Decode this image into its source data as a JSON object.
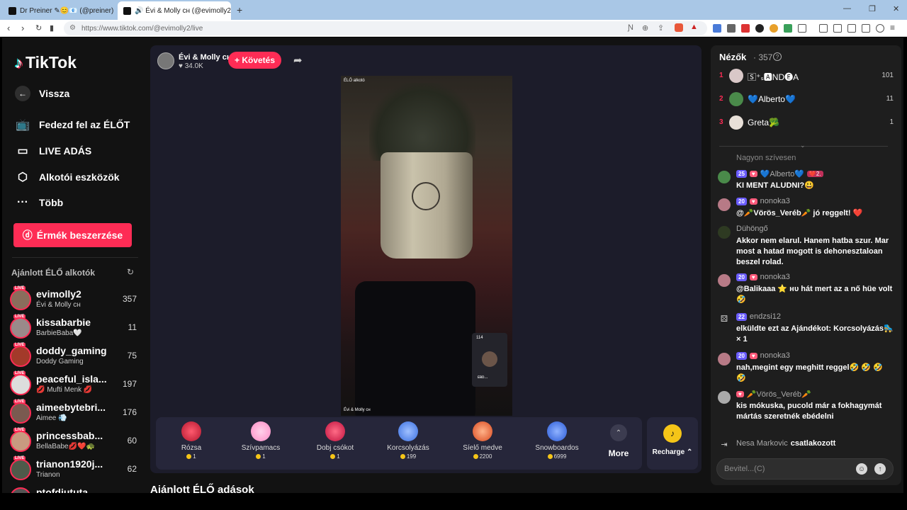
{
  "browser": {
    "tabs": [
      {
        "title": "Dr Preiner ✎😊📧 (@preiner) ÉLŐ",
        "active": false
      },
      {
        "title": "🔊 Évi & Molly ᴄʜ (@evimolly2) É",
        "active": true
      }
    ],
    "new_tab": "+",
    "url": "https://www.tiktok.com/@evimolly2/live",
    "window_controls": [
      "—",
      "❐",
      "✕"
    ]
  },
  "sidebar": {
    "logo": "TikTok",
    "back": "Vissza",
    "nav": [
      {
        "label": "Fedezd fel az ÉLŐT",
        "icon": "tv-icon"
      },
      {
        "label": "LIVE ADÁS",
        "icon": "camera-icon"
      },
      {
        "label": "Alkotói eszközök",
        "icon": "creator-tools-icon"
      },
      {
        "label": "Több",
        "icon": "more-icon"
      }
    ],
    "coins_button": "Érmék beszerzése",
    "recommended_title": "Ajánlott ÉLŐ alkotók",
    "live_badge": "LIVE",
    "creators": [
      {
        "name": "evimolly2",
        "sub": "Évi & Molly ᴄʜ",
        "count": "357"
      },
      {
        "name": "kissabarbie",
        "sub": "BarbieBaba🤍",
        "count": "11"
      },
      {
        "name": "doddy_gaming",
        "sub": "Doddy Gaming",
        "count": "75"
      },
      {
        "name": "peaceful_isla...",
        "sub": "💋 Mufti Menk 💋",
        "count": "197"
      },
      {
        "name": "aimeebytebri...",
        "sub": "Aimee 💨",
        "count": "176"
      },
      {
        "name": "princessbab...",
        "sub": "BellaBabe💋❤️🐢",
        "count": "60"
      },
      {
        "name": "trianon1920j...",
        "sub": "Trianon",
        "count": "62"
      },
      {
        "name": "ptofdiututa",
        "sub": "",
        "count": ""
      }
    ]
  },
  "live": {
    "host_name": "Évi & Molly ᴄʜ",
    "host_likes": "♥ 34.0K",
    "follow_button": "+ Követés",
    "top_caption": "ÉLŐ alkotó",
    "bottom_caption": "Évi & Molly ᴄʜ",
    "pip_count": "114",
    "pip_name": "ᴇʙᴅ...",
    "gifts": [
      {
        "name": "Rózsa",
        "price": "1",
        "color": "#e8324f"
      },
      {
        "name": "Szívpamacs",
        "price": "1",
        "color": "#ff9fd2"
      },
      {
        "name": "Dobj csókot",
        "price": "1",
        "color": "#e0245e"
      },
      {
        "name": "Korcsolyázás",
        "price": "199",
        "color": "#5b8cff"
      },
      {
        "name": "Síelő medve",
        "price": "2200",
        "color": "#ff6a3d"
      },
      {
        "name": "Snowboardos",
        "price": "6999",
        "color": "#3d7bff"
      }
    ],
    "more_label": "More",
    "recharge_label": "Recharge ⌃",
    "recommended_live_title": "Ajánlott ÉLŐ adások"
  },
  "chat": {
    "viewers_title": "Nézők",
    "viewers_count": "· 357",
    "top_viewers": [
      {
        "rank": "1",
        "name": "🅂⁺ₛ🅰ND🅔A",
        "score": "101"
      },
      {
        "rank": "2",
        "name": "💙Alberto💙",
        "score": "11"
      },
      {
        "rank": "3",
        "name": "Greta🥦",
        "score": "1"
      }
    ],
    "messages": [
      {
        "user": "",
        "badge": "",
        "text": "Nagyon szívesen"
      },
      {
        "user": "💙Alberto💙",
        "badge": "25",
        "extra": "❤️2.",
        "text": "KI MENT ALUDNI?😃"
      },
      {
        "user": "nonoka3",
        "badge": "20",
        "text": "@🥕Vörös_Veréb🥕 jó reggelt! ❤️"
      },
      {
        "user": "Dühöngő",
        "badge": "",
        "text": "Akkor nem elarul. Hanem hatba szur. Mar most a hatad mogott is dehonesztaloan beszel rolad."
      },
      {
        "user": "nonoka3",
        "badge": "20",
        "text": "@Balikaaa ⭐ ʜᴜ hát mert az a nő hüe volt🤣"
      },
      {
        "user": "endzsi12",
        "badge": "22",
        "text": "elküldte ezt az Ajándékot: Korcsolyázás🛼 × 1"
      },
      {
        "user": "nonoka3",
        "badge": "20",
        "text": "nah,megint egy meghitt reggel🤣 🤣 🤣 🤣"
      },
      {
        "user": "🥕Vörös_Veréb🥕",
        "badge": "",
        "text": "kis mókuska, pucold már a fokhagymát mártás szeretnék ebédelni"
      }
    ],
    "join_user": "Nesa Markovic",
    "join_text": "csatlakozott",
    "input_placeholder": "Bevitel...(C)"
  },
  "colors": {
    "accent": "#fe2c55",
    "page_bg": "#121212",
    "live_bg": "#1c1c2a",
    "chat_bg": "#1e1e1e"
  }
}
